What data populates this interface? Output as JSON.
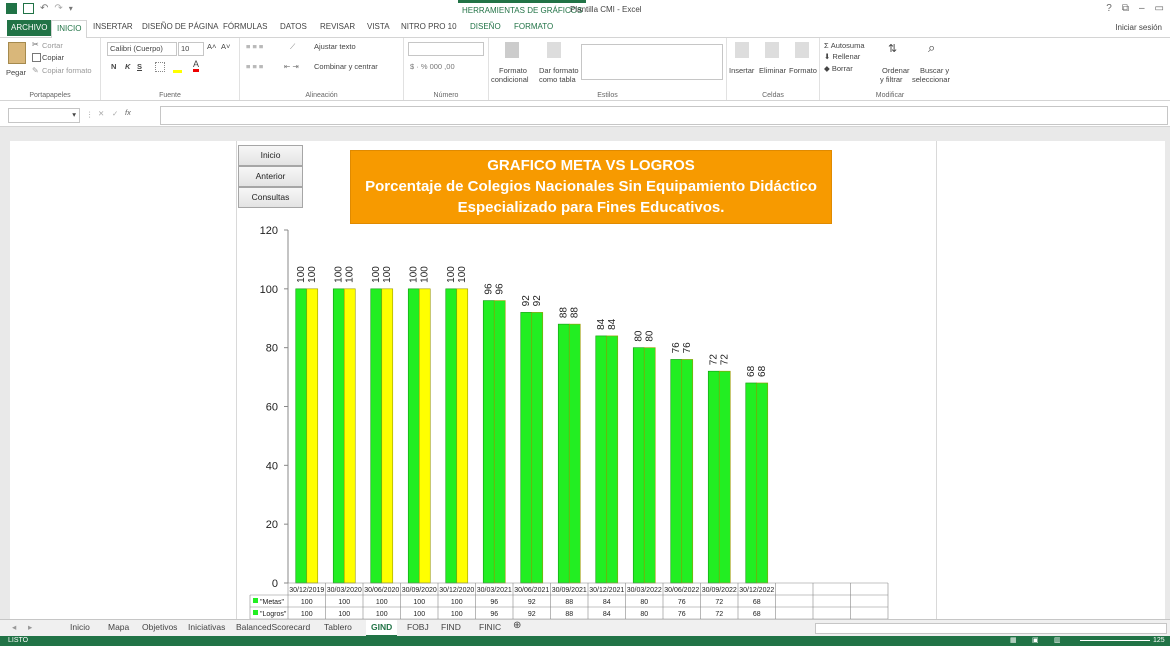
{
  "title_bar": {
    "context_tools": "HERRAMIENTAS DE GRÁFICOS",
    "window_title": "Plantilla CMI - Excel",
    "help": "?",
    "minimize": "–",
    "restore": "⧉",
    "close": "✕"
  },
  "ribbon_tabs": [
    {
      "label": "ARCHIVO"
    },
    {
      "label": "INICIO"
    },
    {
      "label": "INSERTAR"
    },
    {
      "label": "DISEÑO DE PÁGINA"
    },
    {
      "label": "FÓRMULAS"
    },
    {
      "label": "DATOS"
    },
    {
      "label": "REVISAR"
    },
    {
      "label": "VISTA"
    },
    {
      "label": "NITRO PRO 10"
    },
    {
      "label": "DISEÑO"
    },
    {
      "label": "FORMATO"
    }
  ],
  "sign_in": "Iniciar sesión",
  "ribbon": {
    "clipboard": {
      "cut": "Cortar",
      "copy": "Copiar",
      "paste": "Pegar",
      "copy_format": "Copiar formato",
      "label": "Portapapeles"
    },
    "font": {
      "font_name": "Calibri (Cuerpo)",
      "font_size": "10",
      "bold": "N",
      "italic": "K",
      "underline": "S",
      "label": "Fuente"
    },
    "alignment": {
      "wrap": "Ajustar texto",
      "merge": "Combinar y centrar",
      "label": "Alineación"
    },
    "number": {
      "label": "Número"
    },
    "styles": {
      "cond_format_1": "Formato",
      "cond_format_2": "condicional",
      "table_format_1": "Dar formato",
      "table_format_2": "como tabla",
      "label": "Estilos"
    },
    "cells": {
      "insert": "Insertar",
      "delete": "Eliminar",
      "format": "Formato",
      "label": "Celdas"
    },
    "editing": {
      "autosum": "Autosuma",
      "fill": "Rellenar",
      "clear": "Borrar",
      "sort_1": "Ordenar",
      "sort_2": "y filtrar",
      "find_1": "Buscar y",
      "find_2": "seleccionar",
      "label": "Modificar"
    }
  },
  "formula_bar": {
    "fx": "fx",
    "cancel": "✕",
    "enter": "✓"
  },
  "nav_buttons": {
    "inicio": "Inicio",
    "anterior": "Anterior",
    "consultas": "Consultas"
  },
  "chart_title": {
    "line1": "GRAFICO META VS LOGROS",
    "line2": "Porcentaje de Colegios Nacionales Sin Equipamiento Didáctico",
    "line3": "Especializado para Fines Educativos."
  },
  "chart_data": {
    "type": "bar",
    "categories": [
      "30/12/2019",
      "30/03/2020",
      "30/06/2020",
      "30/09/2020",
      "30/12/2020",
      "30/03/2021",
      "30/06/2021",
      "30/09/2021",
      "30/12/2021",
      "30/03/2022",
      "30/06/2022",
      "30/09/2022",
      "30/12/2022"
    ],
    "series": [
      {
        "name": "\"Metas\"",
        "color": "#22ee22",
        "values": [
          100,
          100,
          100,
          100,
          100,
          96,
          92,
          88,
          84,
          80,
          76,
          72,
          68
        ]
      },
      {
        "name": "\"Logros\"",
        "values": [
          100,
          100,
          100,
          100,
          100,
          96,
          92,
          88,
          84,
          80,
          76,
          72,
          68
        ]
      }
    ],
    "logros_colors": [
      "#ffff00",
      "#ffff00",
      "#ffff00",
      "#ffff00",
      "#ffff00",
      "#22ee22",
      "#22ee22",
      "#22ee22",
      "#22ee22",
      "#22ee22",
      "#22ee22",
      "#22ee22",
      "#22ee22"
    ],
    "ylim": [
      0,
      120
    ],
    "yticks": [
      0,
      20,
      40,
      60,
      80,
      100,
      120
    ],
    "legend": "data-table"
  },
  "sheet_tabs": [
    "Inicio",
    "Mapa",
    "Objetivos",
    "Iniciativas",
    "BalancedScorecard",
    "Tablero",
    "GIND",
    "FOBJ",
    "FIND",
    "FINIC"
  ],
  "active_sheet": "GIND",
  "add_sheet": "⊕",
  "status": {
    "ready": "LISTO",
    "zoom": "125"
  }
}
